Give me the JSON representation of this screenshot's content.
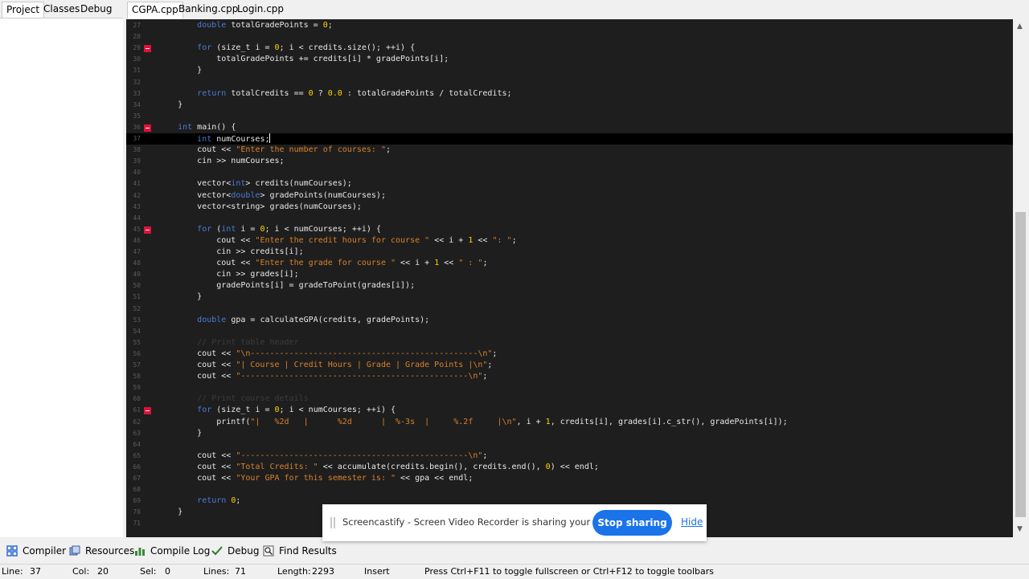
{
  "left_tabs": [
    "Project",
    "Classes",
    "Debug"
  ],
  "editor_tabs": [
    "CGPA.cpp",
    "Banking.cpp",
    "Login.cpp"
  ],
  "code_lines": [
    {
      "num": "27",
      "fold": false,
      "segs": [
        [
          "",
          "        "
        ],
        [
          "kw",
          "double"
        ],
        [
          "",
          " totalGradePoints = "
        ],
        [
          "num",
          "0"
        ],
        [
          "",
          ";"
        ]
      ]
    },
    {
      "num": "28",
      "fold": false,
      "segs": [
        [
          "",
          ""
        ]
      ]
    },
    {
      "num": "29",
      "fold": true,
      "segs": [
        [
          "",
          "        "
        ],
        [
          "kw",
          "for"
        ],
        [
          "",
          " (size_t i = "
        ],
        [
          "num",
          "0"
        ],
        [
          "",
          "; i < credits.size(); ++i) {"
        ]
      ]
    },
    {
      "num": "30",
      "fold": false,
      "segs": [
        [
          "",
          "            totalGradePoints += credits[i] * gradePoints[i];"
        ]
      ]
    },
    {
      "num": "31",
      "fold": false,
      "segs": [
        [
          "",
          "        }"
        ]
      ]
    },
    {
      "num": "32",
      "fold": false,
      "segs": [
        [
          "",
          ""
        ]
      ]
    },
    {
      "num": "33",
      "fold": false,
      "segs": [
        [
          "",
          "        "
        ],
        [
          "kw",
          "return"
        ],
        [
          "",
          " totalCredits == "
        ],
        [
          "num",
          "0"
        ],
        [
          "",
          " ? "
        ],
        [
          "num",
          "0.0"
        ],
        [
          "",
          " : totalGradePoints / totalCredits;"
        ]
      ]
    },
    {
      "num": "34",
      "fold": false,
      "segs": [
        [
          "",
          "    }"
        ]
      ]
    },
    {
      "num": "35",
      "fold": false,
      "segs": [
        [
          "",
          ""
        ]
      ]
    },
    {
      "num": "36",
      "fold": true,
      "segs": [
        [
          "",
          "    "
        ],
        [
          "kw",
          "int"
        ],
        [
          "",
          " main() {"
        ]
      ]
    },
    {
      "num": "37",
      "fold": false,
      "current": true,
      "segs": [
        [
          "",
          "        "
        ],
        [
          "kw",
          "int"
        ],
        [
          "",
          " numCourses;"
        ]
      ]
    },
    {
      "num": "38",
      "fold": false,
      "segs": [
        [
          "",
          "        cout << "
        ],
        [
          "str",
          "\"Enter the number of courses: \""
        ],
        [
          "",
          ";"
        ]
      ]
    },
    {
      "num": "39",
      "fold": false,
      "segs": [
        [
          "",
          "        cin >> numCourses;"
        ]
      ]
    },
    {
      "num": "40",
      "fold": false,
      "segs": [
        [
          "",
          ""
        ]
      ]
    },
    {
      "num": "41",
      "fold": false,
      "segs": [
        [
          "",
          "        vector<"
        ],
        [
          "kw",
          "int"
        ],
        [
          "",
          "> credits(numCourses);"
        ]
      ]
    },
    {
      "num": "42",
      "fold": false,
      "segs": [
        [
          "",
          "        vector<"
        ],
        [
          "kw",
          "double"
        ],
        [
          "",
          "> gradePoints(numCourses);"
        ]
      ]
    },
    {
      "num": "43",
      "fold": false,
      "segs": [
        [
          "",
          "        vector<string> grades(numCourses);"
        ]
      ]
    },
    {
      "num": "44",
      "fold": false,
      "segs": [
        [
          "",
          ""
        ]
      ]
    },
    {
      "num": "45",
      "fold": true,
      "segs": [
        [
          "",
          "        "
        ],
        [
          "kw",
          "for"
        ],
        [
          "",
          " ("
        ],
        [
          "kw",
          "int"
        ],
        [
          "",
          " i = "
        ],
        [
          "num",
          "0"
        ],
        [
          "",
          "; i < numCourses; ++i) {"
        ]
      ]
    },
    {
      "num": "46",
      "fold": false,
      "segs": [
        [
          "",
          "            cout << "
        ],
        [
          "str",
          "\"Enter the credit hours for course \""
        ],
        [
          "",
          " << i + "
        ],
        [
          "num",
          "1"
        ],
        [
          "",
          " << "
        ],
        [
          "str",
          "\": \""
        ],
        [
          "",
          ";"
        ]
      ]
    },
    {
      "num": "47",
      "fold": false,
      "segs": [
        [
          "",
          "            cin >> credits[i];"
        ]
      ]
    },
    {
      "num": "48",
      "fold": false,
      "segs": [
        [
          "",
          "            cout << "
        ],
        [
          "str",
          "\"Enter the grade for course \""
        ],
        [
          "",
          " << i + "
        ],
        [
          "num",
          "1"
        ],
        [
          "",
          " << "
        ],
        [
          "str",
          "\" : \""
        ],
        [
          "",
          ";"
        ]
      ]
    },
    {
      "num": "49",
      "fold": false,
      "segs": [
        [
          "",
          "            cin >> grades[i];"
        ]
      ]
    },
    {
      "num": "50",
      "fold": false,
      "segs": [
        [
          "",
          "            gradePoints[i] = gradeToPoint(grades[i]);"
        ]
      ]
    },
    {
      "num": "51",
      "fold": false,
      "segs": [
        [
          "",
          "        }"
        ]
      ]
    },
    {
      "num": "52",
      "fold": false,
      "segs": [
        [
          "",
          ""
        ]
      ]
    },
    {
      "num": "53",
      "fold": false,
      "segs": [
        [
          "",
          "        "
        ],
        [
          "kw",
          "double"
        ],
        [
          "",
          " gpa = calculateGPA(credits, gradePoints);"
        ]
      ]
    },
    {
      "num": "54",
      "fold": false,
      "segs": [
        [
          "",
          ""
        ]
      ]
    },
    {
      "num": "55",
      "fold": false,
      "segs": [
        [
          "",
          "        "
        ],
        [
          "cmt",
          "// Print table header"
        ]
      ]
    },
    {
      "num": "56",
      "fold": false,
      "segs": [
        [
          "",
          "        cout << "
        ],
        [
          "str",
          "\"\\n-----------------------------------------------\\n\""
        ],
        [
          "",
          ";"
        ]
      ]
    },
    {
      "num": "57",
      "fold": false,
      "segs": [
        [
          "",
          "        cout << "
        ],
        [
          "str",
          "\"| Course | Credit Hours | Grade | Grade Points |\\n\""
        ],
        [
          "",
          ";"
        ]
      ]
    },
    {
      "num": "58",
      "fold": false,
      "segs": [
        [
          "",
          "        cout << "
        ],
        [
          "str",
          "\"-----------------------------------------------\\n\""
        ],
        [
          "",
          ";"
        ]
      ]
    },
    {
      "num": "59",
      "fold": false,
      "segs": [
        [
          "",
          ""
        ]
      ]
    },
    {
      "num": "60",
      "fold": false,
      "segs": [
        [
          "",
          "        "
        ],
        [
          "cmt",
          "// Print course details"
        ]
      ]
    },
    {
      "num": "61",
      "fold": true,
      "segs": [
        [
          "",
          "        "
        ],
        [
          "kw",
          "for"
        ],
        [
          "",
          " (size_t i = "
        ],
        [
          "num",
          "0"
        ],
        [
          "",
          "; i < numCourses; ++i) {"
        ]
      ]
    },
    {
      "num": "62",
      "fold": false,
      "segs": [
        [
          "",
          "            printf("
        ],
        [
          "str",
          "\"|   %2d   |      %2d      |  %-3s  |     %.2f     |\\n\""
        ],
        [
          "",
          ", i + "
        ],
        [
          "num",
          "1"
        ],
        [
          "",
          ", credits[i], grades[i].c_str(), gradePoints[i]);"
        ]
      ]
    },
    {
      "num": "63",
      "fold": false,
      "segs": [
        [
          "",
          "        }"
        ]
      ]
    },
    {
      "num": "64",
      "fold": false,
      "segs": [
        [
          "",
          ""
        ]
      ]
    },
    {
      "num": "65",
      "fold": false,
      "segs": [
        [
          "",
          "        cout << "
        ],
        [
          "str",
          "\"-----------------------------------------------\\n\""
        ],
        [
          "",
          ";"
        ]
      ]
    },
    {
      "num": "66",
      "fold": false,
      "segs": [
        [
          "",
          "        cout << "
        ],
        [
          "str",
          "\"Total Credits: \""
        ],
        [
          "",
          " << accumulate(credits.begin(), credits.end(), "
        ],
        [
          "num",
          "0"
        ],
        [
          "",
          ") << endl;"
        ]
      ]
    },
    {
      "num": "67",
      "fold": false,
      "segs": [
        [
          "",
          "        cout << "
        ],
        [
          "str",
          "\"Your GPA for this semester is: \""
        ],
        [
          "",
          " << gpa << endl;"
        ]
      ]
    },
    {
      "num": "68",
      "fold": false,
      "segs": [
        [
          "",
          ""
        ]
      ]
    },
    {
      "num": "69",
      "fold": false,
      "segs": [
        [
          "",
          "        "
        ],
        [
          "kw",
          "return"
        ],
        [
          "",
          " "
        ],
        [
          "num",
          "0"
        ],
        [
          "",
          ";"
        ]
      ]
    },
    {
      "num": "70",
      "fold": false,
      "segs": [
        [
          "",
          "    }"
        ]
      ]
    },
    {
      "num": "71",
      "fold": false,
      "segs": [
        [
          "",
          ""
        ]
      ]
    }
  ],
  "bottom_tabs": [
    {
      "label": "Compiler",
      "icon": "grid-icon"
    },
    {
      "label": "Resources",
      "icon": "resources-icon"
    },
    {
      "label": "Compile Log",
      "icon": "chart-icon"
    },
    {
      "label": "Debug",
      "icon": "check-icon"
    },
    {
      "label": "Find Results",
      "icon": "find-icon"
    }
  ],
  "status": {
    "line_label": "Line:",
    "line_value": "37",
    "col_label": "Col:",
    "col_value": "20",
    "sel_label": "Sel:",
    "sel_value": "0",
    "lines_label": "Lines:",
    "lines_value": "71",
    "length_label": "Length:",
    "length_value": "2293",
    "mode": "Insert",
    "hint": "Press Ctrl+F11 to toggle fullscreen or Ctrl+F12 to toggle toolbars"
  },
  "banner": {
    "message": "Screencastify - Screen Video Recorder is sharing your screen.",
    "stop_label": "Stop sharing",
    "hide_label": "Hide"
  },
  "colors": {
    "editor_bg": "#1e1e1e",
    "keyword": "#4a7bd8",
    "string": "#d9822b",
    "number": "#ffd700",
    "fold_marker": "#e0103a",
    "banner_button": "#1a73e8"
  }
}
